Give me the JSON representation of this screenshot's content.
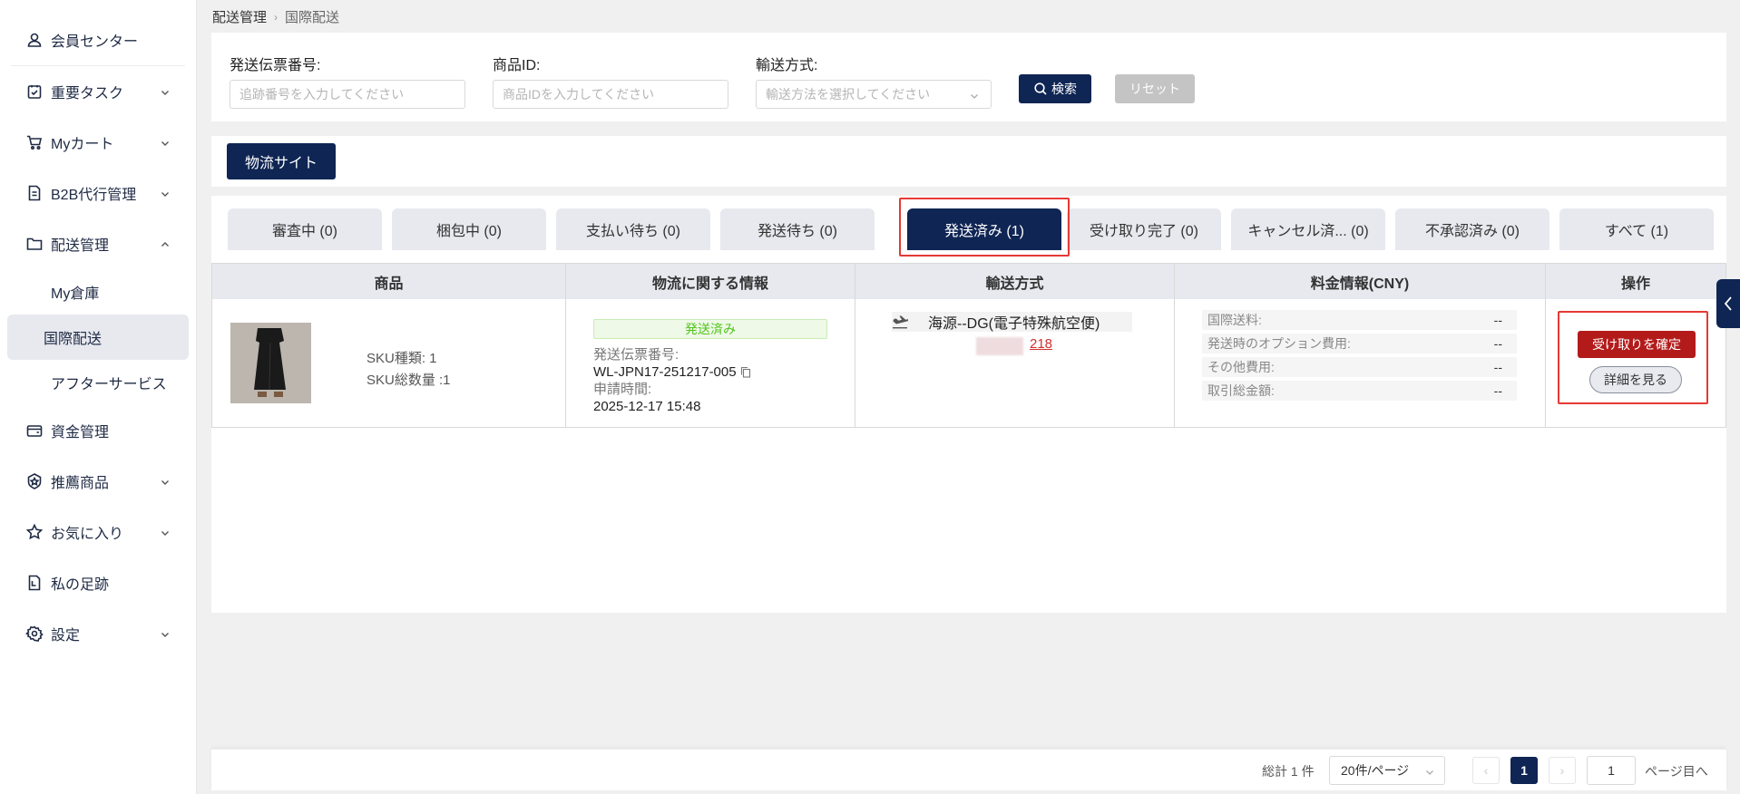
{
  "sidebar": {
    "items": [
      {
        "label": "会員センター",
        "icon": "user-icon",
        "chevron": null
      },
      {
        "label": "重要タスク",
        "icon": "task-icon",
        "chevron": "down"
      },
      {
        "label": "Myカート",
        "icon": "cart-icon",
        "chevron": "down"
      },
      {
        "label": "B2B代行管理",
        "icon": "document-icon",
        "chevron": "down"
      },
      {
        "label": "配送管理",
        "icon": "folder-icon",
        "chevron": "up"
      },
      {
        "label": "資金管理",
        "icon": "wallet-icon",
        "chevron": null
      },
      {
        "label": "推薦商品",
        "icon": "badge-icon",
        "chevron": "down"
      },
      {
        "label": "お気に入り",
        "icon": "star-icon",
        "chevron": "down"
      },
      {
        "label": "私の足跡",
        "icon": "history-icon",
        "chevron": null
      },
      {
        "label": "設定",
        "icon": "gear-icon",
        "chevron": "down"
      }
    ],
    "sub_items": [
      {
        "label": "My倉庫"
      },
      {
        "label": "国際配送",
        "active": true
      },
      {
        "label": "アフターサービス"
      }
    ]
  },
  "breadcrumb": {
    "parent": "配送管理",
    "current": "国際配送"
  },
  "filters": {
    "tracking": {
      "label": "発送伝票番号:",
      "placeholder": "追跡番号を入力してください"
    },
    "product": {
      "label": "商品ID:",
      "placeholder": "商品IDを入力してください"
    },
    "shipping": {
      "label": "輸送方式:",
      "placeholder": "輸送方法を選択してください"
    },
    "search_label": "検索",
    "reset_label": "リセット"
  },
  "logistics_button": "物流サイト",
  "tabs": [
    {
      "label": "審査中 (0)"
    },
    {
      "label": "梱包中 (0)"
    },
    {
      "label": "支払い待ち (0)"
    },
    {
      "label": "発送待ち (0)"
    },
    {
      "label": "発送済み (1)",
      "active": true
    },
    {
      "label": "受け取り完了 (0)"
    },
    {
      "label": "キャンセル済... (0)"
    },
    {
      "label": "不承認済み (0)"
    },
    {
      "label": "すべて (1)"
    }
  ],
  "table": {
    "headers": [
      "商品",
      "物流に関する情報",
      "輸送方式",
      "料金情報(CNY)",
      "操作"
    ],
    "row": {
      "sku_type": "SKU種類: 1",
      "sku_total": "SKU総数量 :1",
      "status": "発送済み",
      "tracking_label": "発送伝票番号:",
      "tracking_value": "WL-JPN17-251217-005",
      "apply_label": "申請時間:",
      "apply_value": "2025-12-17 15:48",
      "shipping_method": "海源--DG(電子特殊航空便)",
      "shipping_link": "218",
      "fees": [
        {
          "label": "国際送料:",
          "value": "--"
        },
        {
          "label": "発送時のオプション費用:",
          "value": "--"
        },
        {
          "label": "その他費用:",
          "value": "--"
        },
        {
          "label": "取引総金額:",
          "value": "--"
        }
      ],
      "confirm_label": "受け取りを確定",
      "detail_label": "詳細を見る"
    }
  },
  "pagination": {
    "total": "総計 1 件",
    "page_size": "20件/ページ",
    "current_page": "1",
    "prev": "‹",
    "next": "›",
    "goto_value": "1",
    "goto_suffix": "ページ目へ"
  },
  "colors": {
    "primary": "#0f2554",
    "danger": "#b31b1b",
    "highlight": "#e53935",
    "success": "#52c41a"
  }
}
